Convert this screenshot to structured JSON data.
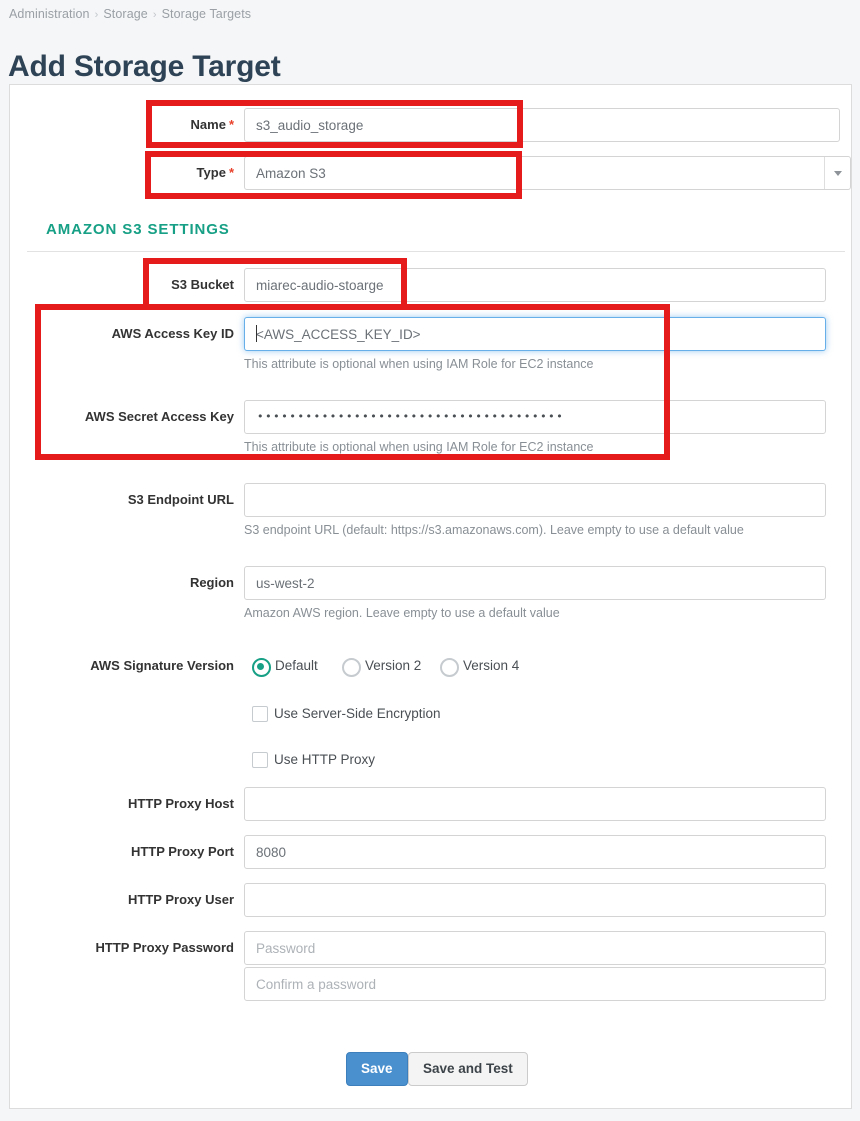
{
  "breadcrumb": {
    "items": [
      "Administration",
      "Storage",
      "Storage Targets"
    ],
    "separator": "›"
  },
  "page_title": "Add Storage Target",
  "form": {
    "name": {
      "label": "Name",
      "required_mark": "*",
      "value": "s3_audio_storage"
    },
    "type": {
      "label": "Type",
      "required_mark": "*",
      "value": "Amazon S3"
    },
    "section_title": "AMAZON S3 SETTINGS",
    "s3_bucket": {
      "label": "S3 Bucket",
      "value": "miarec-audio-stoarge"
    },
    "access_key_id": {
      "label": "AWS Access Key ID",
      "value": "<AWS_ACCESS_KEY_ID>",
      "help": "This attribute is optional when using IAM Role for EC2 instance"
    },
    "secret_access_key": {
      "label": "AWS Secret Access Key",
      "value": "••••••••••••••••••••••••••••••••••••••",
      "help": "This attribute is optional when using IAM Role for EC2 instance"
    },
    "endpoint_url": {
      "label": "S3 Endpoint URL",
      "value": "",
      "help": "S3 endpoint URL (default: https://s3.amazonaws.com). Leave empty to use a default value"
    },
    "region": {
      "label": "Region",
      "value": "us-west-2",
      "help": "Amazon AWS region. Leave empty to use a default value"
    },
    "signature_version": {
      "label": "AWS Signature Version",
      "options": [
        "Default",
        "Version 2",
        "Version 4"
      ],
      "selected": "Default"
    },
    "server_side_encryption": {
      "label": "Use Server-Side Encryption",
      "checked": false
    },
    "use_http_proxy": {
      "label": "Use HTTP Proxy",
      "checked": false
    },
    "proxy_host": {
      "label": "HTTP Proxy Host",
      "value": ""
    },
    "proxy_port": {
      "label": "HTTP Proxy Port",
      "value": "8080"
    },
    "proxy_user": {
      "label": "HTTP Proxy User",
      "value": ""
    },
    "proxy_password": {
      "label": "HTTP Proxy Password",
      "placeholder": "Password",
      "confirm_placeholder": "Confirm a password"
    }
  },
  "buttons": {
    "save": "Save",
    "save_and_test": "Save and Test"
  },
  "colors": {
    "accent_teal": "#17a085",
    "primary_blue": "#4a90cf",
    "required_red": "#e8402a",
    "annotation_red": "#e51b1b",
    "title_navy": "#2e4355"
  }
}
